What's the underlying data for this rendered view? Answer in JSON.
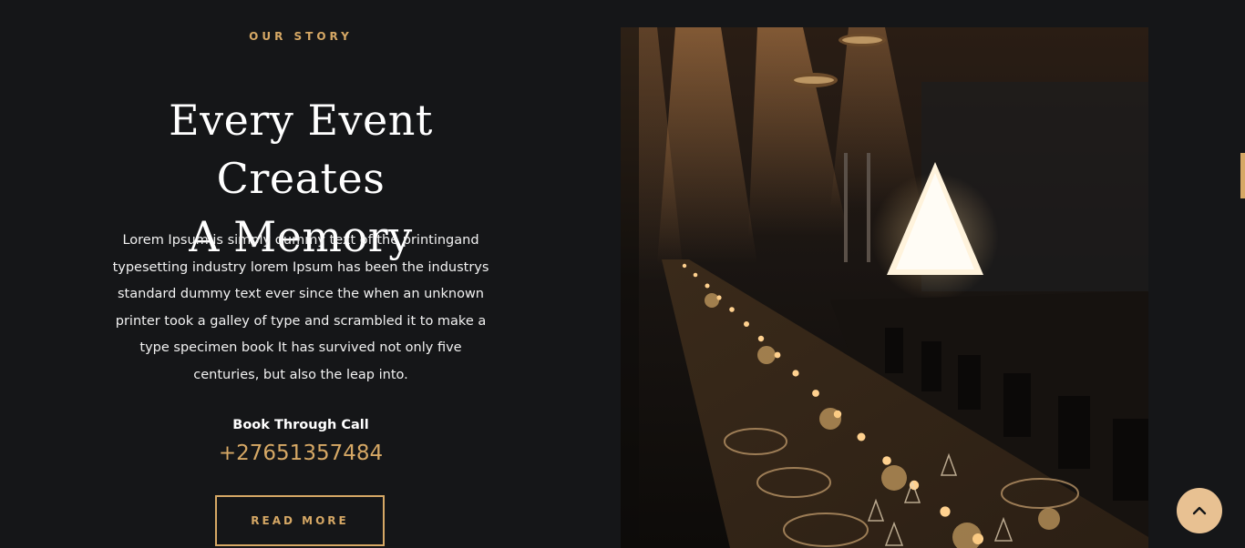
{
  "story": {
    "eyebrow": "OUR STORY",
    "title_line1": "Every Event Creates",
    "title_line2": "A Memory",
    "body": "Lorem Ipsum is simply dummy text of the printingand typesetting industry lorem Ipsum has been the industrys standard dummy text ever since the when an unknown printer took a galley of type and scrambled it to make a type specimen book It has survived not only five centuries, but also the leap into.",
    "call_label": "Book Through Call",
    "phone": "+27651357484",
    "cta_label": "READ MORE"
  },
  "icons": {
    "scroll_top": "chevron-up-icon"
  },
  "colors": {
    "background": "#151618",
    "accent": "#d6a865",
    "scroll_button": "#e8c192"
  }
}
